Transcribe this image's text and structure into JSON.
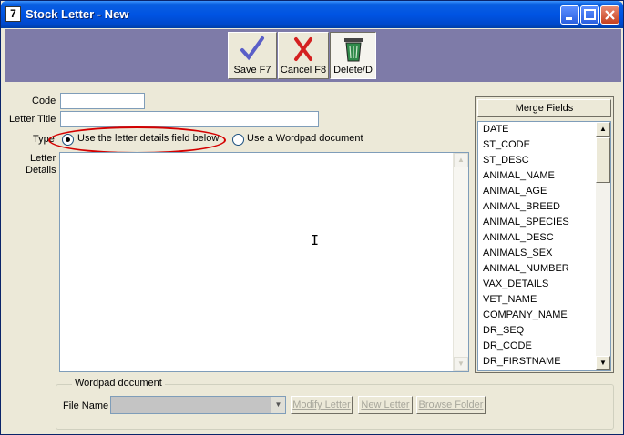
{
  "window": {
    "title": "Stock Letter - New",
    "app_icon_glyph": "7"
  },
  "toolbar": {
    "save_label": "Save F7",
    "cancel_label": "Cancel F8",
    "delete_label": "Delete/D"
  },
  "form": {
    "code_label": "Code",
    "code_value": "",
    "title_label": "Letter Title",
    "title_value": "",
    "type_label": "Type",
    "type_option_details": "Use the letter details field below",
    "type_option_wordpad": "Use a Wordpad document",
    "type_selected": "details",
    "details_label_1": "Letter",
    "details_label_2": "Details",
    "details_value": ""
  },
  "merge_fields": {
    "header": "Merge Fields",
    "items": [
      "DATE",
      "ST_CODE",
      "ST_DESC",
      "ANIMAL_NAME",
      "ANIMAL_AGE",
      "ANIMAL_BREED",
      "ANIMAL_SPECIES",
      "ANIMAL_DESC",
      "ANIMALS_SEX",
      "ANIMAL_NUMBER",
      "VAX_DETAILS",
      "VET_NAME",
      "COMPANY_NAME",
      "DR_SEQ",
      "DR_CODE",
      "DR_FIRSTNAME"
    ]
  },
  "wordpad": {
    "group_title": "Wordpad document",
    "file_name_label": "File Name",
    "file_name_value": "",
    "modify_button": "Modify Letter",
    "new_button": "New Letter",
    "browse_button": "Browse Folder"
  },
  "colors": {
    "titlebar": "#0054e3",
    "toolbar_band": "#7e7ba8",
    "highlight": "#d40000"
  }
}
